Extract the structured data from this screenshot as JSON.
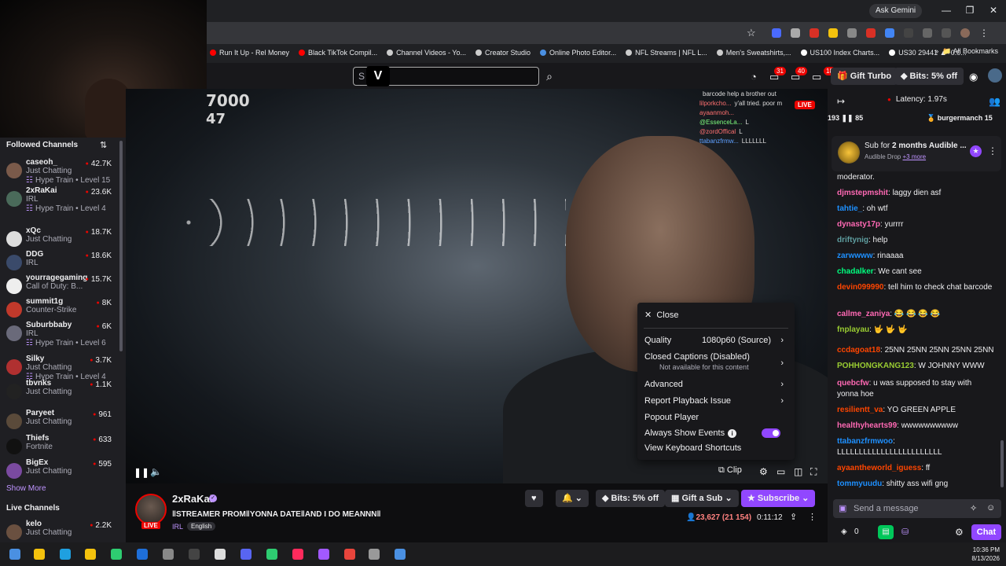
{
  "browser": {
    "ask_gemini": "Ask Gemini",
    "bookmarks": [
      "Run It Up - Rel Money",
      "Black TikTok Compil...",
      "Channel Videos - Yo...",
      "Creator Studio",
      "Online Photo Editor...",
      "NFL Streams | NFL L...",
      "Men's Sweatshirts,...",
      "US100 Index Charts...",
      "US30 29441 ▲+0.0..."
    ],
    "all_bookmarks": "All Bookmarks",
    "win_min": "—",
    "win_max": "❐",
    "win_close": "✕"
  },
  "twitch_header": {
    "search_placeholder": "S",
    "badges": [
      "31",
      "40",
      "18"
    ],
    "gift_turbo": "Gift Turbo",
    "bits_promo": "Bits: 5% off"
  },
  "sidebar": {
    "title": "Followed Channels",
    "channels": [
      {
        "name": "caseoh_",
        "game": "Just Chatting",
        "viewers": "42.7K",
        "hype": "Hype Train • Level 15",
        "color": "#7a5a4a"
      },
      {
        "name": "2xRaKai",
        "game": "IRL",
        "viewers": "23.6K",
        "hype": "Hype Train • Level 4",
        "color": "#4a6a5a"
      },
      {
        "name": "xQc",
        "game": "Just Chatting",
        "viewers": "18.7K",
        "hype": "",
        "color": "#ddd"
      },
      {
        "name": "DDG",
        "game": "IRL",
        "viewers": "18.6K",
        "hype": "",
        "color": "#3a4a6a"
      },
      {
        "name": "yourragegaming",
        "game": "Call of Duty: B...",
        "viewers": "15.7K",
        "hype": "",
        "color": "#eee"
      },
      {
        "name": "summit1g",
        "game": "Counter-Strike",
        "viewers": "8K",
        "hype": "",
        "color": "#c0392b"
      },
      {
        "name": "Suburbbaby",
        "game": "IRL",
        "viewers": "6K",
        "hype": "Hype Train • Level 6",
        "color": "#6a6a7a"
      },
      {
        "name": "Silky",
        "game": "Just Chatting",
        "viewers": "3.7K",
        "hype": "Hype Train • Level 4",
        "color": "#b03030"
      },
      {
        "name": "tbvnks",
        "game": "Just Chatting",
        "viewers": "1.1K",
        "hype": "",
        "color": "#222"
      },
      {
        "name": "Paryeet",
        "game": "Just Chatting",
        "viewers": "961",
        "hype": "",
        "color": "#5a4a3a"
      },
      {
        "name": "Thiefs",
        "game": "Fortnite",
        "viewers": "633",
        "hype": "",
        "color": "#111"
      },
      {
        "name": "BigEx",
        "game": "Just Chatting",
        "viewers": "595",
        "hype": "",
        "color": "#7a4aa0"
      }
    ],
    "show_more": "Show More",
    "live_channels": "Live Channels",
    "live": [
      {
        "name": "kelo",
        "game": "Just Chatting",
        "viewers": "2.2K",
        "color": "#6a5040"
      }
    ]
  },
  "video": {
    "overlay_numbers": [
      "7000",
      "47"
    ],
    "live": "LIVE",
    "overlay_chat": [
      {
        "user": "",
        "text": "barcode help a brother out"
      },
      {
        "user": "lilporkcho...",
        "text": "y'all tried. poor m"
      },
      {
        "user": "ayaanmoh...",
        "text": ""
      },
      {
        "user": "@EssenceLa...",
        "text": "L"
      },
      {
        "user": "@zordOffical",
        "text": "L"
      },
      {
        "user": "ttabanzfrmw...",
        "text": "LLLLLLL"
      }
    ],
    "clip": "Clip"
  },
  "settings_menu": {
    "close": "Close",
    "quality_label": "Quality",
    "quality_value": "1080p60 (Source)",
    "captions_label": "Closed Captions (Disabled)",
    "captions_sub": "Not available for this content",
    "advanced": "Advanced",
    "report": "Report Playback Issue",
    "popout": "Popout Player",
    "always_show": "Always Show Events",
    "shortcuts": "View Keyboard Shortcuts"
  },
  "stream_info": {
    "streamer": "2xRaKai",
    "title": "‖STREAMER PROM‖YONNA DATE‖AND I DO MEANNN‖",
    "category": "IRL",
    "language": "English",
    "live": "LIVE",
    "bits": "Bits: 5% off",
    "gift_sub": "Gift a Sub",
    "subscribe": "Subscribe",
    "viewers": "23,627 (21 154)",
    "uptime": "0:11:12"
  },
  "chat": {
    "latency": "Latency: 1.97s",
    "hype_left": "193 ❚❚ 85",
    "hype_right": "burgermanch",
    "hype_right_num": "15",
    "drop_title_pre": "Sub for ",
    "drop_title_bold": "2 months Audible ...",
    "drop_sub": "Audible Drop",
    "drop_more": "+3 more",
    "messages": [
      {
        "user": "",
        "text": "moderator.",
        "color": "#efeff1"
      },
      {
        "user": "djmstepmshit",
        "text": ": laggy dien asf",
        "color": "#ff69b4"
      },
      {
        "user": "tahtie_",
        "text": ": oh wtf",
        "color": "#1e90ff"
      },
      {
        "user": "dynasty17p",
        "text": ": yurrrr",
        "color": "#ff69b4"
      },
      {
        "user": "driftynig",
        "text": ": help",
        "color": "#5f9ea0"
      },
      {
        "user": "zarwwww",
        "text": ": rinaaaa",
        "color": "#1e90ff"
      },
      {
        "user": "chadalker",
        "text": ": We cant see",
        "color": "#00ff7f"
      },
      {
        "user": "devin099990",
        "text": ": tell him to check chat barcode",
        "color": "#ff4500"
      },
      {
        "user": "callme_zaniya",
        "text": ": 😂 😂 😂 😂",
        "color": "#ff69b4"
      },
      {
        "user": "fnplayau",
        "text": ": 🤟 🤟 🤟",
        "color": "#9acd32"
      },
      {
        "user": "ccdagoat18",
        "text": ": 25NN 25NN 25NN 25NN 25NN",
        "color": "#ff4500"
      },
      {
        "user": "POHHONGKANG123",
        "text": ": W JOHNNY WWW",
        "color": "#9acd32"
      },
      {
        "user": "quebcfw",
        "text": ": u was supposed to stay with yonna hoe",
        "color": "#ff69b4"
      },
      {
        "user": "resilientt_va",
        "text": ": YO GREEN APPLE",
        "color": "#ff4500"
      },
      {
        "user": "healthyhearts99",
        "text": ": wwwwwwwwww",
        "color": "#ff69b4"
      },
      {
        "user": "ttabanzfrmwoo",
        "text": ": LLLLLLLLLLLLLLLLLLLLLLLL",
        "color": "#1e90ff"
      },
      {
        "user": "ayaantheworld_iguess",
        "text": ": ff",
        "color": "#ff4500"
      },
      {
        "user": "tommyuudu",
        "text": ": shitty ass wifi gng",
        "color": "#1e90ff"
      }
    ],
    "input_placeholder": "Send a message",
    "points": "0",
    "chat_button": "Chat"
  },
  "taskbar": {
    "time": "10:36 PM",
    "date": "8/13/2026"
  }
}
